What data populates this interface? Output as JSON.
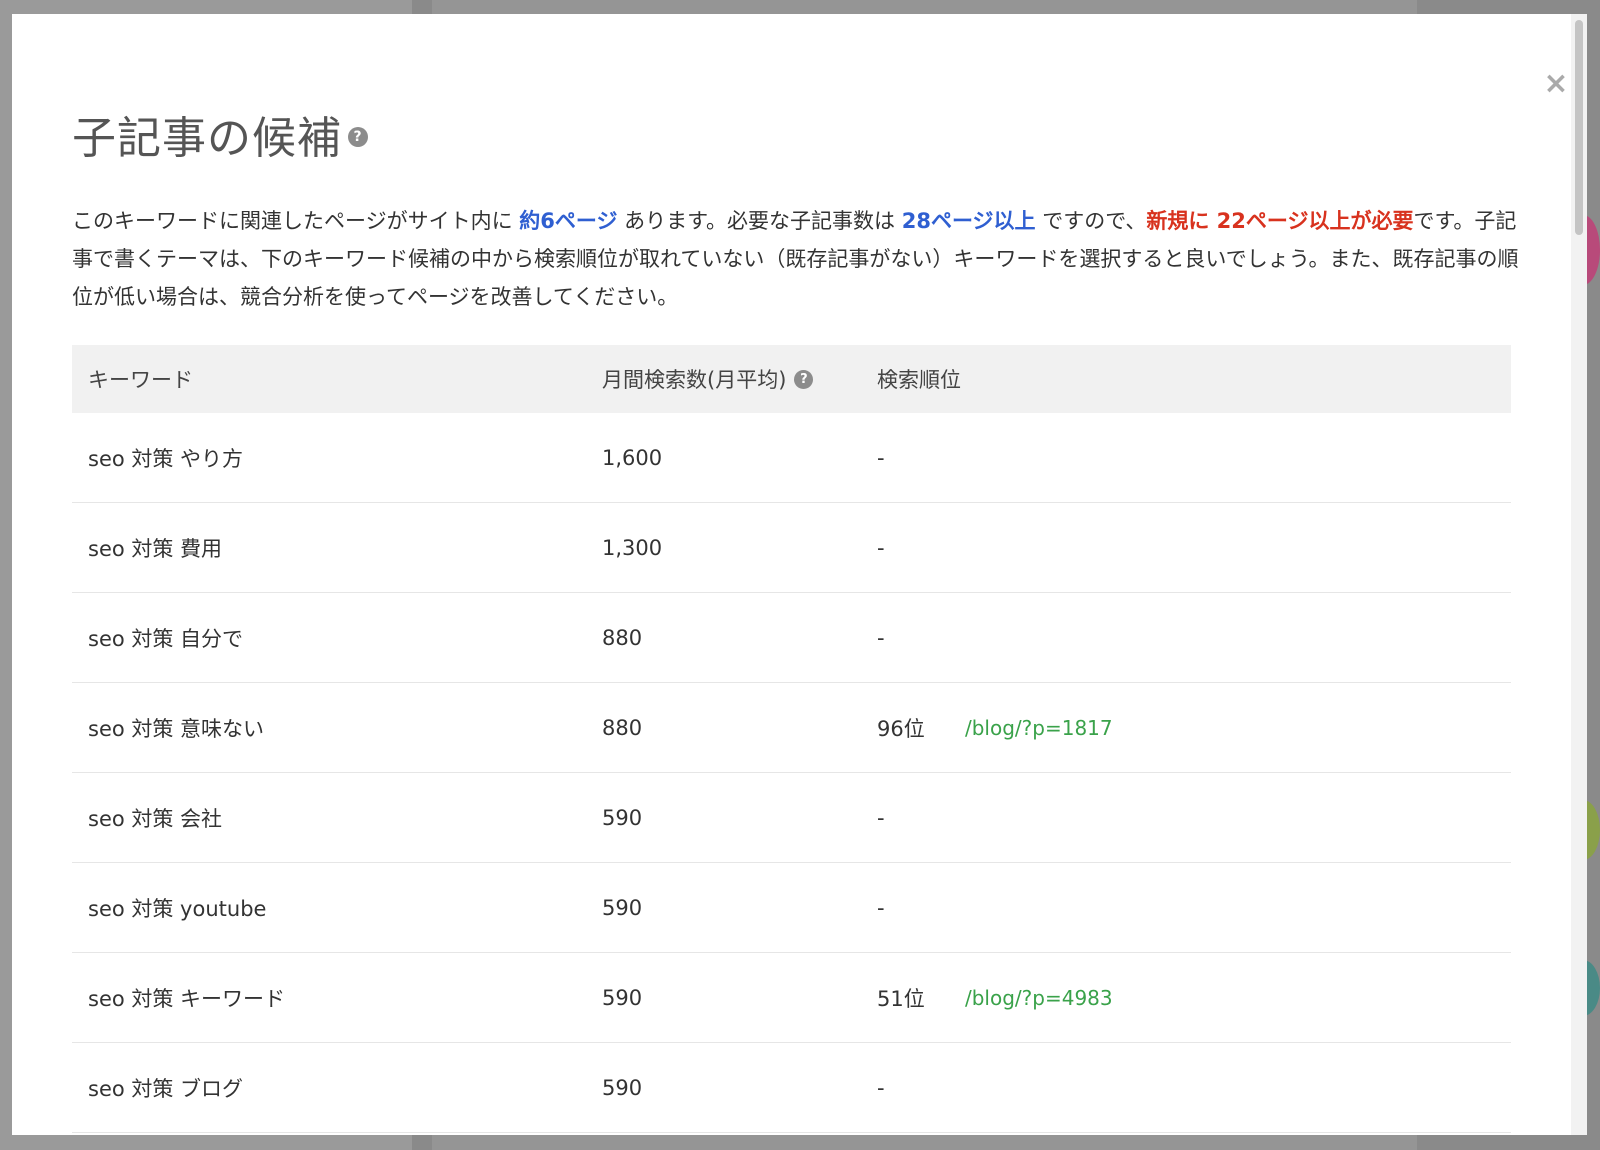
{
  "modal": {
    "title": "子記事の候補",
    "close_icon": "close-icon",
    "description": {
      "p1": "このキーワードに関連したページがサイト内に ",
      "existing_pages": "約6ページ",
      "p2": " あります。必要な子記事数は ",
      "required_pages": "28ページ以上",
      "p3": " ですので、",
      "new_pages": "新規に 22ページ以上が必要",
      "p4": "です。子記事で書くテーマは、下のキーワード候補の中から検索順位が取れていない（既存記事がない）キーワードを選択すると良いでしょう。また、既存記事の順位が低い場合は、競合分析を使ってページを改善してください。"
    }
  },
  "table": {
    "headers": {
      "keyword": "キーワード",
      "volume": "月間検索数(月平均)",
      "rank": "検索順位"
    },
    "rows": [
      {
        "keyword": "seo 対策 やり方",
        "volume": "1,600",
        "rank": "-",
        "url": ""
      },
      {
        "keyword": "seo 対策 費用",
        "volume": "1,300",
        "rank": "-",
        "url": ""
      },
      {
        "keyword": "seo 対策 自分で",
        "volume": "880",
        "rank": "-",
        "url": ""
      },
      {
        "keyword": "seo 対策 意味ない",
        "volume": "880",
        "rank": "96位",
        "url": "/blog/?p=1817"
      },
      {
        "keyword": "seo 対策 会社",
        "volume": "590",
        "rank": "-",
        "url": ""
      },
      {
        "keyword": "seo 対策 youtube",
        "volume": "590",
        "rank": "-",
        "url": ""
      },
      {
        "keyword": "seo 対策 キーワード",
        "volume": "590",
        "rank": "51位",
        "url": "/blog/?p=4983"
      },
      {
        "keyword": "seo 対策 ブログ",
        "volume": "590",
        "rank": "-",
        "url": ""
      }
    ]
  },
  "colors": {
    "accent_blue": "#2f5fd1",
    "accent_red": "#d8321e",
    "link_green": "#3aa24a"
  }
}
